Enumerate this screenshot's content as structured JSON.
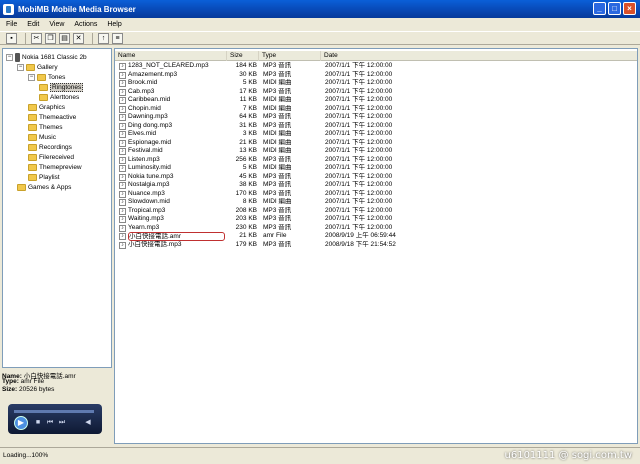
{
  "window": {
    "title": "MobiMB Mobile Media Browser",
    "minimize": "_",
    "maximize": "□",
    "close": "×"
  },
  "menu": [
    "File",
    "Edit",
    "View",
    "Actions",
    "Help"
  ],
  "toolbar": {
    "icons": [
      "save-icon",
      "cut-icon",
      "copy-icon",
      "paste-icon",
      "delete-icon",
      "folder-up-icon",
      "properties-icon"
    ]
  },
  "tree": [
    {
      "label": "Nokia 1681 Classic 2b",
      "level": 0,
      "icon": "phone-icon",
      "expander": "−"
    },
    {
      "label": "Gallery",
      "level": 1,
      "icon": "folder-open-icon",
      "expander": "−"
    },
    {
      "label": "Tones",
      "level": 2,
      "icon": "folder-open-icon",
      "expander": "−"
    },
    {
      "label": "Ringtones",
      "level": 3,
      "icon": "folder-icon",
      "selected": true
    },
    {
      "label": "Alerttones",
      "level": 3,
      "icon": "folder-icon"
    },
    {
      "label": "Graphics",
      "level": 2,
      "icon": "folder-icon"
    },
    {
      "label": "Themeactive",
      "level": 2,
      "icon": "folder-icon"
    },
    {
      "label": "Themes",
      "level": 2,
      "icon": "folder-icon"
    },
    {
      "label": "Music",
      "level": 2,
      "icon": "folder-icon"
    },
    {
      "label": "Recordings",
      "level": 2,
      "icon": "folder-icon"
    },
    {
      "label": "Filereceived",
      "level": 2,
      "icon": "folder-icon"
    },
    {
      "label": "Themepreview",
      "level": 2,
      "icon": "folder-icon"
    },
    {
      "label": "Playlist",
      "level": 2,
      "icon": "folder-icon"
    },
    {
      "label": "Games & Apps",
      "level": 1,
      "icon": "folder-icon"
    }
  ],
  "info": {
    "name_label": "Name:",
    "name": "小白快接電話.amr",
    "type_label": "Type:",
    "type": "amr File",
    "size_label": "Size:",
    "size": "20526 bytes"
  },
  "player": {
    "play_icon": "play-icon",
    "stop_icon": "stop-icon",
    "prev_icon": "previous-icon",
    "next_icon": "next-icon",
    "volume_icon": "volume-icon"
  },
  "list": {
    "columns": [
      "Name",
      "Size",
      "Type",
      "Date"
    ],
    "rows": [
      {
        "name": "1283_NOT_CLEARED.mp3",
        "size": "184 KB",
        "type": "MP3 音訊",
        "date": "2007/1/1 下午 12:00:00"
      },
      {
        "name": "Amazement.mp3",
        "size": "30 KB",
        "type": "MP3 音訊",
        "date": "2007/1/1 下午 12:00:00"
      },
      {
        "name": "Brook.mid",
        "size": "5 KB",
        "type": "MIDI 編曲",
        "date": "2007/1/1 下午 12:00:00"
      },
      {
        "name": "Cab.mp3",
        "size": "17 KB",
        "type": "MP3 音訊",
        "date": "2007/1/1 下午 12:00:00"
      },
      {
        "name": "Caribbean.mid",
        "size": "11 KB",
        "type": "MIDI 編曲",
        "date": "2007/1/1 下午 12:00:00"
      },
      {
        "name": "Chopin.mid",
        "size": "7 KB",
        "type": "MIDI 編曲",
        "date": "2007/1/1 下午 12:00:00"
      },
      {
        "name": "Dawning.mp3",
        "size": "64 KB",
        "type": "MP3 音訊",
        "date": "2007/1/1 下午 12:00:00"
      },
      {
        "name": "Ding dong.mp3",
        "size": "31 KB",
        "type": "MP3 音訊",
        "date": "2007/1/1 下午 12:00:00"
      },
      {
        "name": "Elves.mid",
        "size": "3 KB",
        "type": "MIDI 編曲",
        "date": "2007/1/1 下午 12:00:00"
      },
      {
        "name": "Espionage.mid",
        "size": "21 KB",
        "type": "MIDI 編曲",
        "date": "2007/1/1 下午 12:00:00"
      },
      {
        "name": "Festival.mid",
        "size": "13 KB",
        "type": "MIDI 編曲",
        "date": "2007/1/1 下午 12:00:00"
      },
      {
        "name": "Listen.mp3",
        "size": "256 KB",
        "type": "MP3 音訊",
        "date": "2007/1/1 下午 12:00:00"
      },
      {
        "name": "Luminosity.mid",
        "size": "5 KB",
        "type": "MIDI 編曲",
        "date": "2007/1/1 下午 12:00:00"
      },
      {
        "name": "Nokia tune.mp3",
        "size": "45 KB",
        "type": "MP3 音訊",
        "date": "2007/1/1 下午 12:00:00"
      },
      {
        "name": "Nostalgia.mp3",
        "size": "38 KB",
        "type": "MP3 音訊",
        "date": "2007/1/1 下午 12:00:00"
      },
      {
        "name": "Nuance.mp3",
        "size": "170 KB",
        "type": "MP3 音訊",
        "date": "2007/1/1 下午 12:00:00"
      },
      {
        "name": "Slowdown.mid",
        "size": "8 KB",
        "type": "MIDI 編曲",
        "date": "2007/1/1 下午 12:00:00"
      },
      {
        "name": "Tropical.mp3",
        "size": "208 KB",
        "type": "MP3 音訊",
        "date": "2007/1/1 下午 12:00:00"
      },
      {
        "name": "Waiting.mp3",
        "size": "203 KB",
        "type": "MP3 音訊",
        "date": "2007/1/1 下午 12:00:00"
      },
      {
        "name": "Yearn.mp3",
        "size": "230 KB",
        "type": "MP3 音訊",
        "date": "2007/1/1 下午 12:00:00"
      },
      {
        "name": "小白快接電話.amr",
        "size": "21 KB",
        "type": "amr File",
        "date": "2008/9/19 上午 06:59:44",
        "highlight": true
      },
      {
        "name": "小白快接電話.mp3",
        "size": "179 KB",
        "type": "MP3 音訊",
        "date": "2008/9/18 下午 21:54:52"
      }
    ]
  },
  "status": {
    "text": "Loading...100%"
  },
  "watermark": "u6101111   @ sogi.com.tw"
}
